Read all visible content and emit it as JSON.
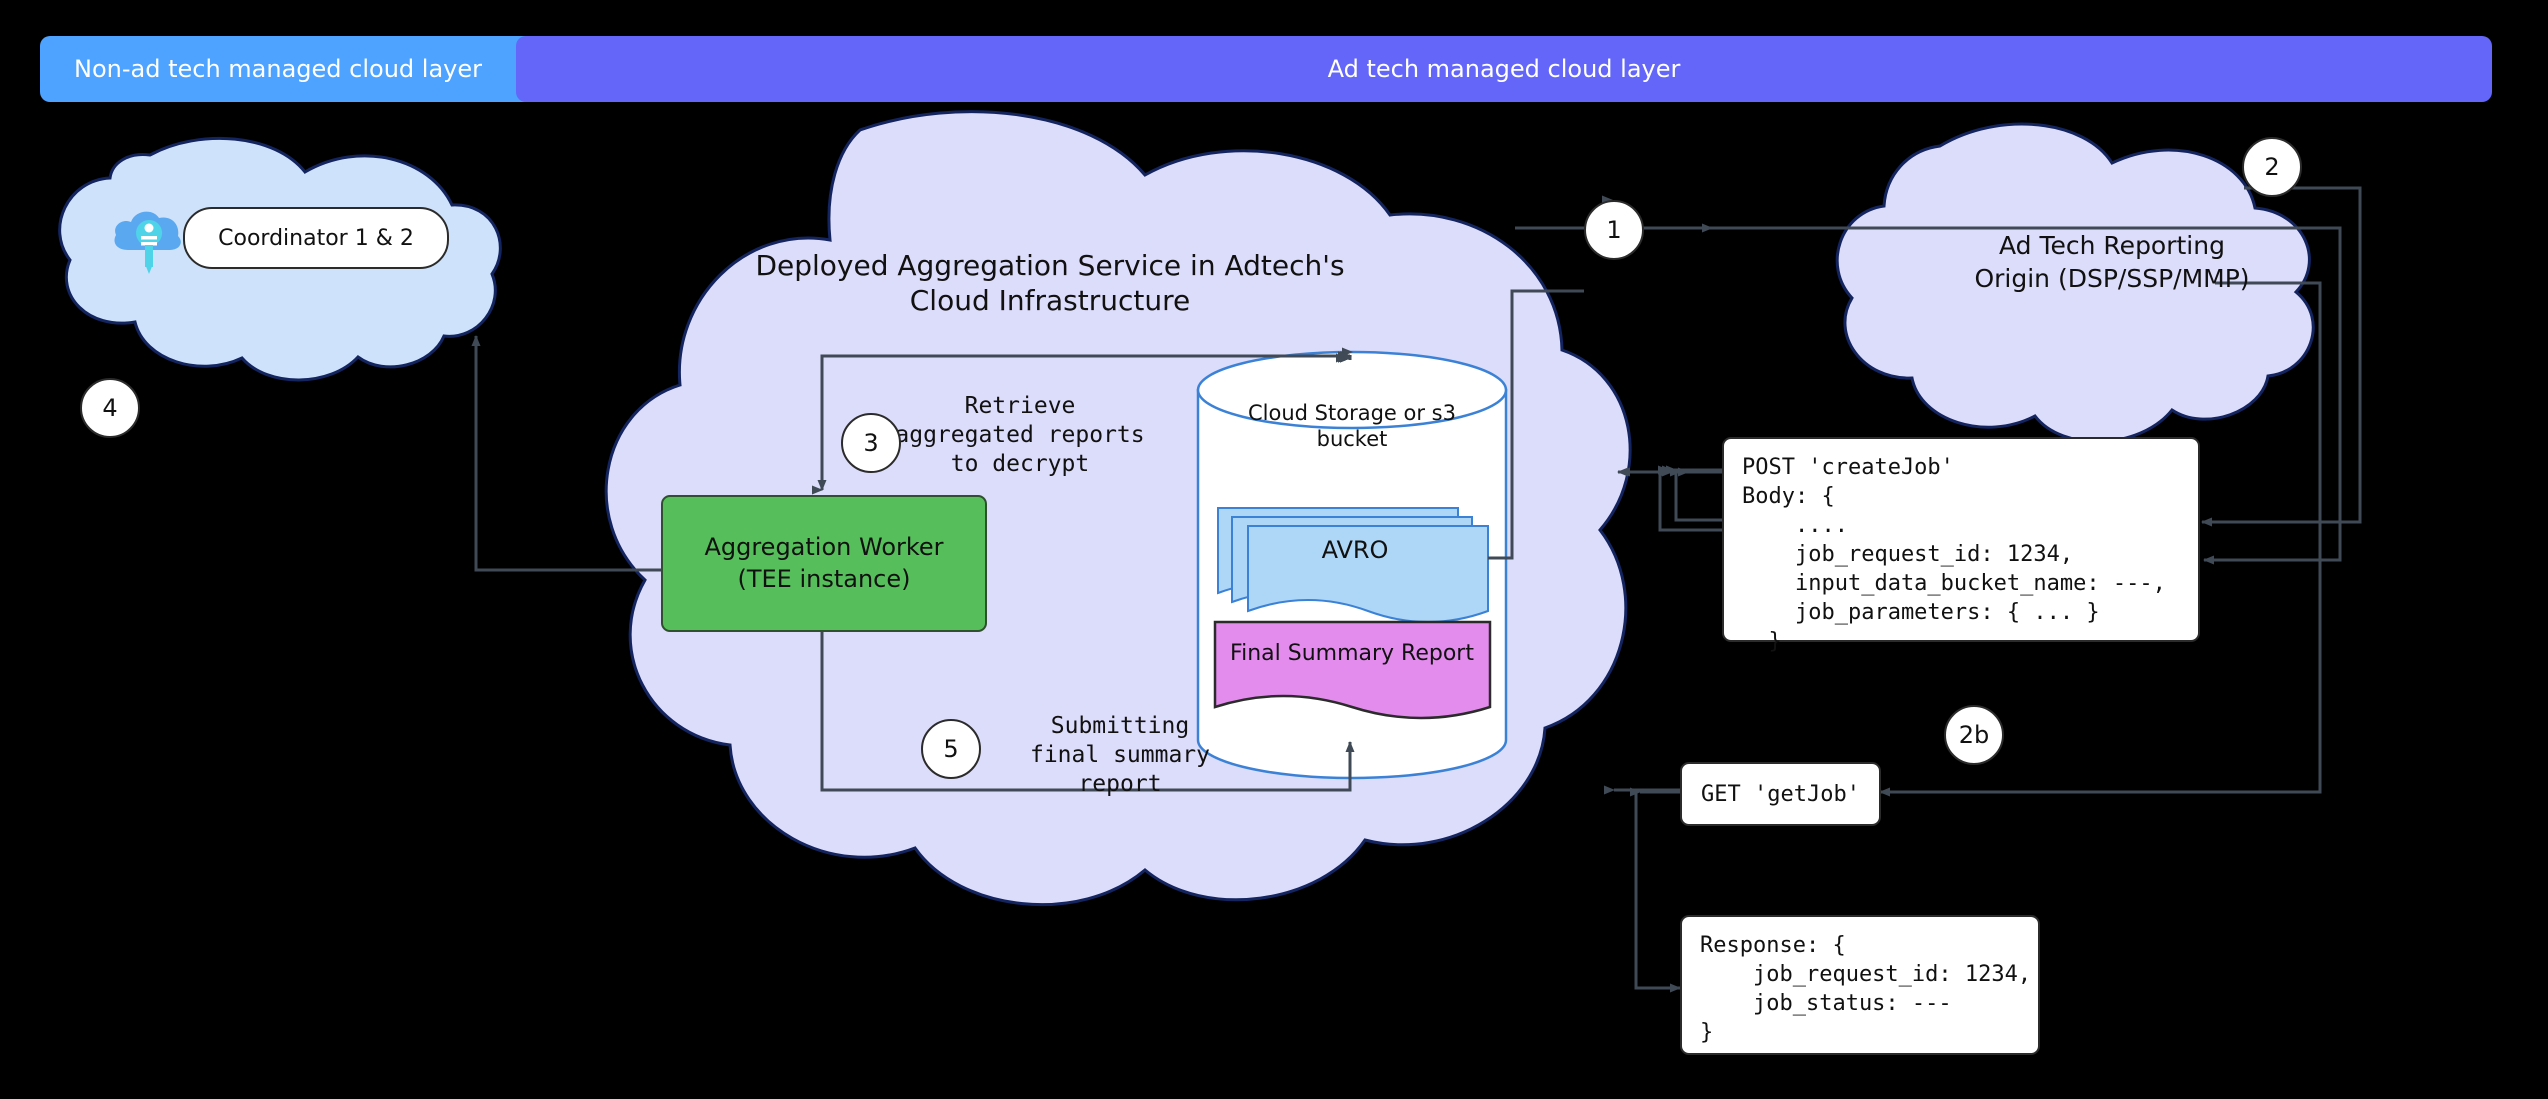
{
  "banners": {
    "non_ad_tech": "Non-ad tech managed cloud layer",
    "ad_tech": "Ad tech managed cloud layer"
  },
  "coordinator": {
    "label": "Coordinator 1 & 2",
    "icon": "cloud-key-icon"
  },
  "main_cloud": {
    "title_line1": "Deployed Aggregation Service in Adtech's",
    "title_line2": "Cloud Infrastructure"
  },
  "worker": {
    "line1": "Aggregation Worker",
    "line2": "(TEE instance)"
  },
  "storage": {
    "title_line1": "Cloud Storage or s3",
    "title_line2": "bucket",
    "avro_label": "AVRO",
    "final_report_label": "Final Summary Report"
  },
  "origin_cloud": {
    "line1": "Ad Tech Reporting",
    "line2": "Origin (DSP/SSP/MMP)"
  },
  "edge_labels": {
    "step3_line1": "Retrieve",
    "step3_line2": "aggregated reports",
    "step3_line3": "to decrypt",
    "step5_line1": "Submitting",
    "step5_line2": "final summary",
    "step5_line3": "report"
  },
  "steps": {
    "one": "1",
    "two": "2",
    "twob": "2b",
    "three": "3",
    "four": "4",
    "five": "5"
  },
  "code": {
    "create_job": "POST 'createJob'\nBody: {\n    ....\n    job_request_id: 1234,\n    input_data_bucket_name: ---,\n    job_parameters: { ... }\n  }",
    "get_job": "GET 'getJob'",
    "response": "Response: {\n    job_request_id: 1234,\n    job_status: ---\n}"
  },
  "colors": {
    "background": "#000000",
    "banner_non_ad": "#4da3ff",
    "banner_ad": "#6366f8",
    "main_cloud_fill": "#dcdcfb",
    "coordinator_cloud_fill": "#cfe2fb",
    "worker_fill": "#56bf5b",
    "avro_fill": "#aed6f7",
    "report_fill": "#e48bee",
    "edge_stroke": "#3f4a56",
    "cloud_stroke": "#13245e"
  }
}
